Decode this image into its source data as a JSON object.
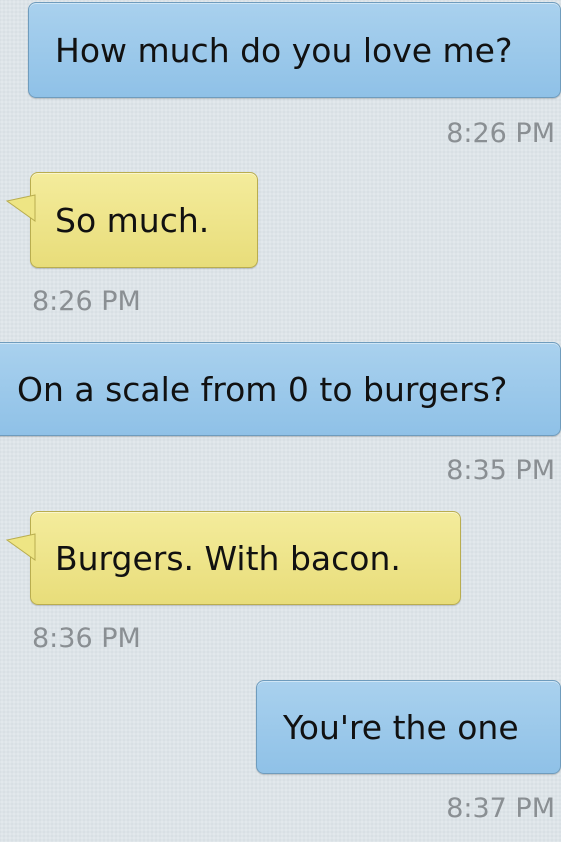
{
  "messages": [
    {
      "direction": "sent",
      "text": "How much do you love me?",
      "time": "8:26 PM"
    },
    {
      "direction": "received",
      "text": "So much.",
      "time": "8:26 PM"
    },
    {
      "direction": "sent",
      "text": "On a scale from 0 to burgers?",
      "time": "8:35 PM"
    },
    {
      "direction": "received",
      "text": "Burgers. With bacon.",
      "time": "8:36 PM"
    },
    {
      "direction": "sent",
      "text": "You're the one",
      "time": "8:37 PM"
    }
  ],
  "colors": {
    "background": "#dde4e8",
    "sent_bubble": "#9ccaeb",
    "received_bubble": "#efe68b",
    "timestamp": "#8a8f93"
  }
}
